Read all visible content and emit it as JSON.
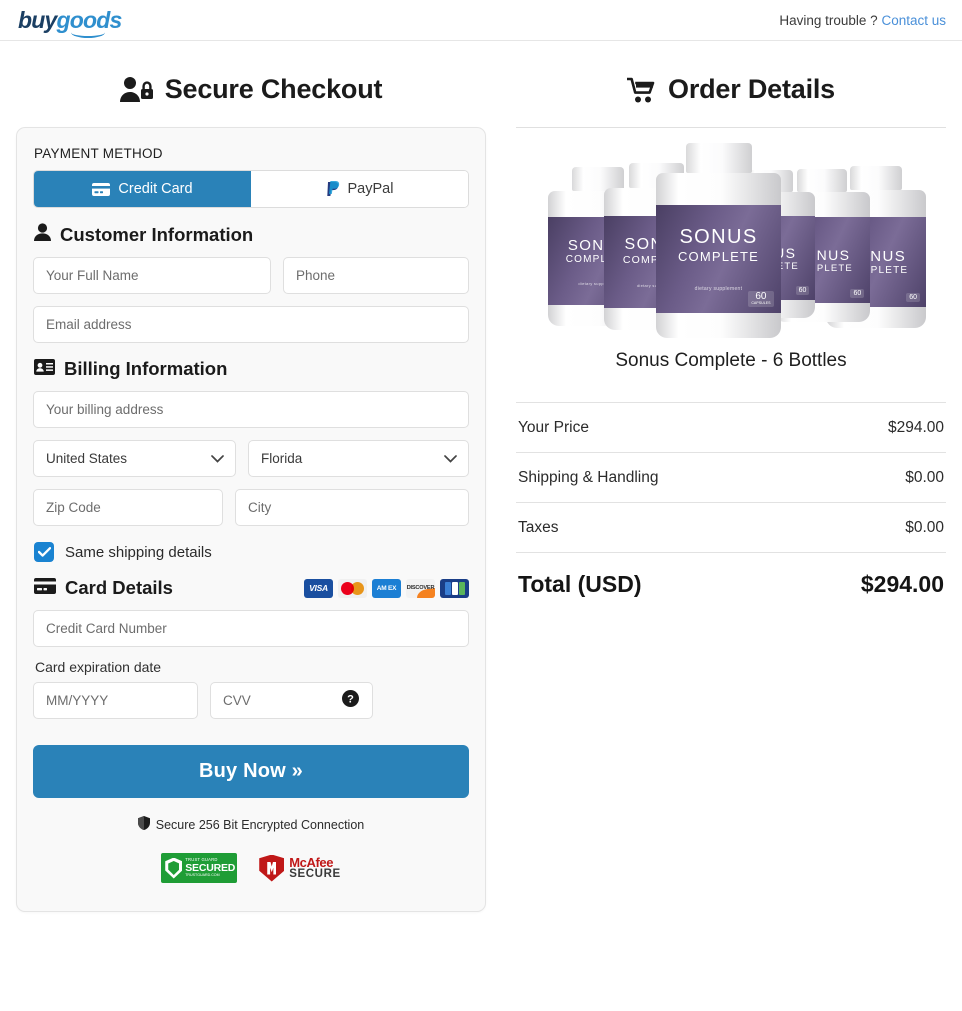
{
  "header": {
    "logo_buy": "buy",
    "logo_goods": "goods",
    "help_text": "Having trouble ?",
    "contact_link": "Contact us"
  },
  "checkout": {
    "title": "Secure Checkout",
    "payment_method_label": "PAYMENT METHOD",
    "tabs": [
      {
        "label": "Credit Card",
        "icon": "credit-card-icon",
        "active": true
      },
      {
        "label": "PayPal",
        "icon": "paypal-icon",
        "active": false
      }
    ],
    "customer_section": {
      "title": "Customer Information",
      "full_name_placeholder": "Your Full Name",
      "full_name_value": "",
      "phone_placeholder": "Phone",
      "phone_value": "",
      "email_placeholder": "Email address",
      "email_value": ""
    },
    "billing_section": {
      "title": "Billing Information",
      "address_placeholder": "Your billing address",
      "address_value": "",
      "country_selected": "United States",
      "state_selected": "Florida",
      "zip_placeholder": "Zip Code",
      "zip_value": "",
      "city_placeholder": "City",
      "city_value": "",
      "same_shipping_label": "Same shipping details",
      "same_shipping_checked": true
    },
    "card_section": {
      "title": "Card Details",
      "accepted_cards": [
        "VISA",
        "Mastercard",
        "AM EX",
        "DISCOVER",
        "JCB"
      ],
      "card_number_placeholder": "Credit Card Number",
      "card_number_value": "",
      "expiration_label": "Card expiration date",
      "expiration_placeholder": "MM/YYYY",
      "expiration_value": "",
      "cvv_placeholder": "CVV",
      "cvv_value": "",
      "cvv_help_icon": "question-circle-icon"
    },
    "buy_button": "Buy Now »",
    "secure_note": "Secure 256 Bit Encrypted Connection",
    "badges": [
      {
        "name": "trust-guard-secured",
        "top": "TRUST GUARD",
        "mid": "SECURED",
        "bottom": "TRUSTGUARD.COM"
      },
      {
        "name": "mcafee-secure",
        "top": "McAfee",
        "bottom": "SECURE"
      }
    ],
    "accent_color": "#2a82b8",
    "checkbox_color": "#1a83d1"
  },
  "order": {
    "title": "Order Details",
    "product_name": "Sonus Complete - 6 Bottles",
    "product_label_line1": "SONUS",
    "product_label_line2": "COMPLETE",
    "product_label_line3": "dietary supplement",
    "product_label_count": "60",
    "product_label_count_unit": "CAPSULES",
    "summary": [
      {
        "label": "Your Price",
        "value": "$294.00"
      },
      {
        "label": "Shipping & Handling",
        "value": "$0.00"
      },
      {
        "label": "Taxes",
        "value": "$0.00"
      }
    ],
    "total_label": "Total (USD)",
    "total_value": "$294.00"
  }
}
